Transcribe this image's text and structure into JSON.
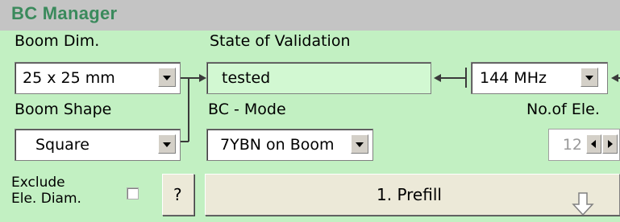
{
  "title": "BC Manager",
  "boom_dim": {
    "label": "Boom Dim.",
    "value": "25 x 25 mm"
  },
  "state": {
    "label": "State of Validation",
    "value": "tested"
  },
  "frequency": {
    "value": "144 MHz"
  },
  "boom_shape": {
    "label": "Boom Shape",
    "value": "Square"
  },
  "bc_mode": {
    "label": "BC - Mode",
    "value": "7YBN on Boom"
  },
  "no_of_ele": {
    "label": "No.of Ele.",
    "value": "12"
  },
  "exclude": {
    "line1": "Exclude",
    "line2": "Ele. Diam."
  },
  "help_button": "?",
  "prefill_button": "1. Prefill",
  "icons": [
    "dropdown-arrow-icon",
    "spin-left-icon",
    "spin-right-icon",
    "down-arrow-icon"
  ]
}
